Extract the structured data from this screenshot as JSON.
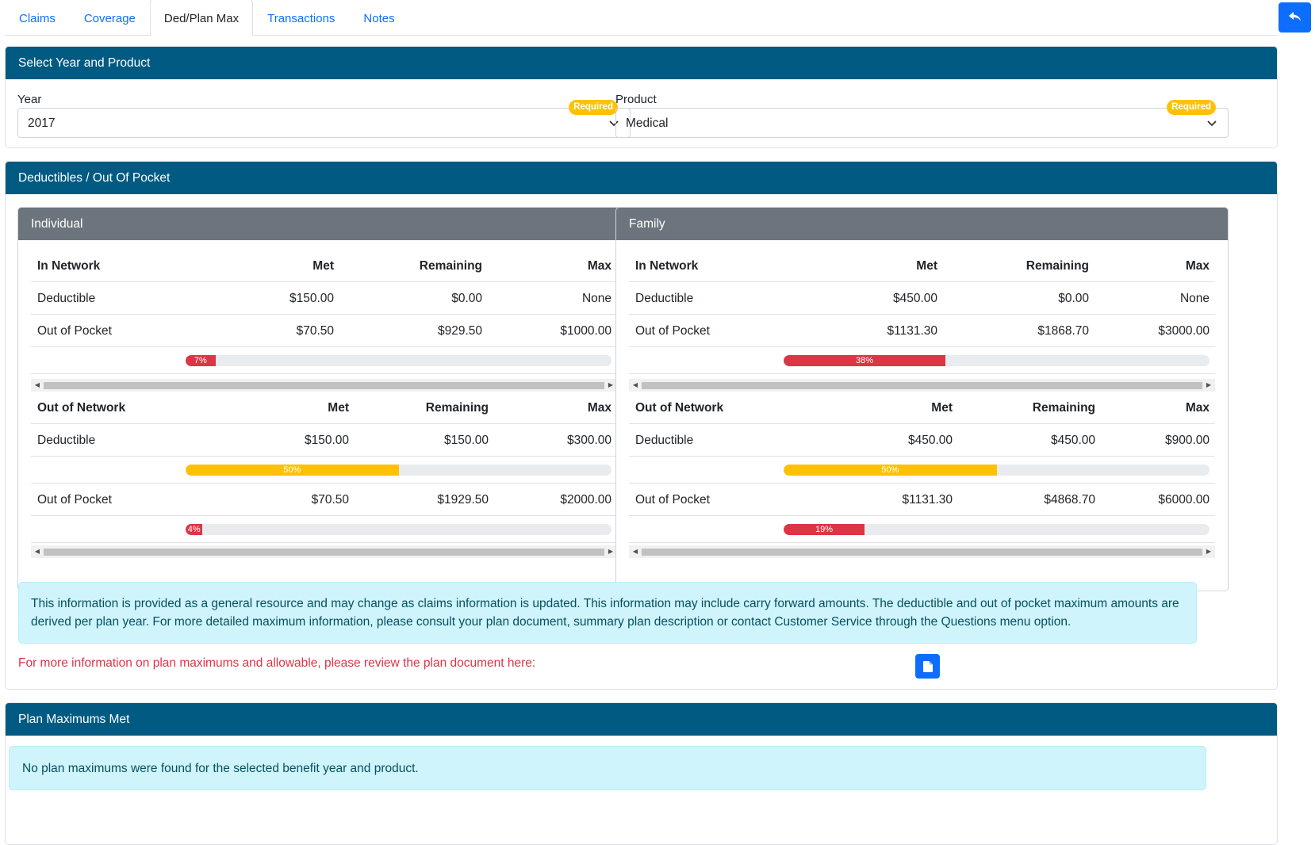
{
  "tabs": [
    {
      "label": "Claims"
    },
    {
      "label": "Coverage"
    },
    {
      "label": "Ded/Plan Max"
    },
    {
      "label": "Transactions"
    },
    {
      "label": "Notes"
    }
  ],
  "active_tab": "Ded/Plan Max",
  "back_button_icon": "reply-arrow-icon",
  "select_section": {
    "title": "Select Year and Product",
    "year": {
      "label": "Year",
      "value": "2017",
      "badge": "Required"
    },
    "product": {
      "label": "Product",
      "value": "Medical",
      "badge": "Required"
    }
  },
  "deductibles": {
    "title": "Deductibles / Out Of Pocket",
    "individual": {
      "title": "Individual",
      "in_network": {
        "headers": [
          "In Network",
          "Met",
          "Remaining",
          "Max"
        ],
        "rows": [
          [
            "Deductible",
            "$150.00",
            "$0.00",
            "None"
          ],
          [
            "Out of Pocket",
            "$70.50",
            "$929.50",
            "$1000.00"
          ]
        ],
        "oop_progress": {
          "percent": 7,
          "label": "7%",
          "color": "#dc3545"
        }
      },
      "out_network": {
        "headers": [
          "Out of Network",
          "Met",
          "Remaining",
          "Max"
        ],
        "rows": [
          [
            "Deductible",
            "$150.00",
            "$150.00",
            "$300.00"
          ],
          [
            "Out of Pocket",
            "$70.50",
            "$1929.50",
            "$2000.00"
          ]
        ],
        "ded_progress": {
          "percent": 50,
          "label": "50%",
          "color": "#ffc107"
        },
        "oop_progress": {
          "percent": 4,
          "label": "4%",
          "color": "#dc3545"
        }
      }
    },
    "family": {
      "title": "Family",
      "in_network": {
        "headers": [
          "In Network",
          "Met",
          "Remaining",
          "Max"
        ],
        "rows": [
          [
            "Deductible",
            "$450.00",
            "$0.00",
            "None"
          ],
          [
            "Out of Pocket",
            "$1131.30",
            "$1868.70",
            "$3000.00"
          ]
        ],
        "oop_progress": {
          "percent": 38,
          "label": "38%",
          "color": "#dc3545"
        }
      },
      "out_network": {
        "headers": [
          "Out of Network",
          "Met",
          "Remaining",
          "Max"
        ],
        "rows": [
          [
            "Deductible",
            "$450.00",
            "$450.00",
            "$900.00"
          ],
          [
            "Out of Pocket",
            "$1131.30",
            "$4868.70",
            "$6000.00"
          ]
        ],
        "ded_progress": {
          "percent": 50,
          "label": "50%",
          "color": "#ffc107"
        },
        "oop_progress": {
          "percent": 19,
          "label": "19%",
          "color": "#dc3545"
        }
      }
    },
    "info_text": "This information is provided as a general resource and may change as claims information is updated. This information may include carry forward amounts. The deductible and out of pocket maximum amounts are derived per plan year. For more detailed maximum information, please consult your plan document, summary plan description or contact Customer Service through the Questions menu option.",
    "plan_doc_note": "For more information on plan maximums and allowable, please review the plan document here:",
    "plan_doc_icon": "document-icon"
  },
  "plan_max": {
    "title": "Plan Maximums Met",
    "message": "No plan maximums were found for the selected benefit year and product."
  },
  "colors": {
    "header_blue": "#005a82",
    "subheader_gray": "#6c757d",
    "link_blue": "#0d6efd",
    "danger": "#dc3545",
    "warning": "#ffc107",
    "info_bg": "#cff4fc"
  }
}
